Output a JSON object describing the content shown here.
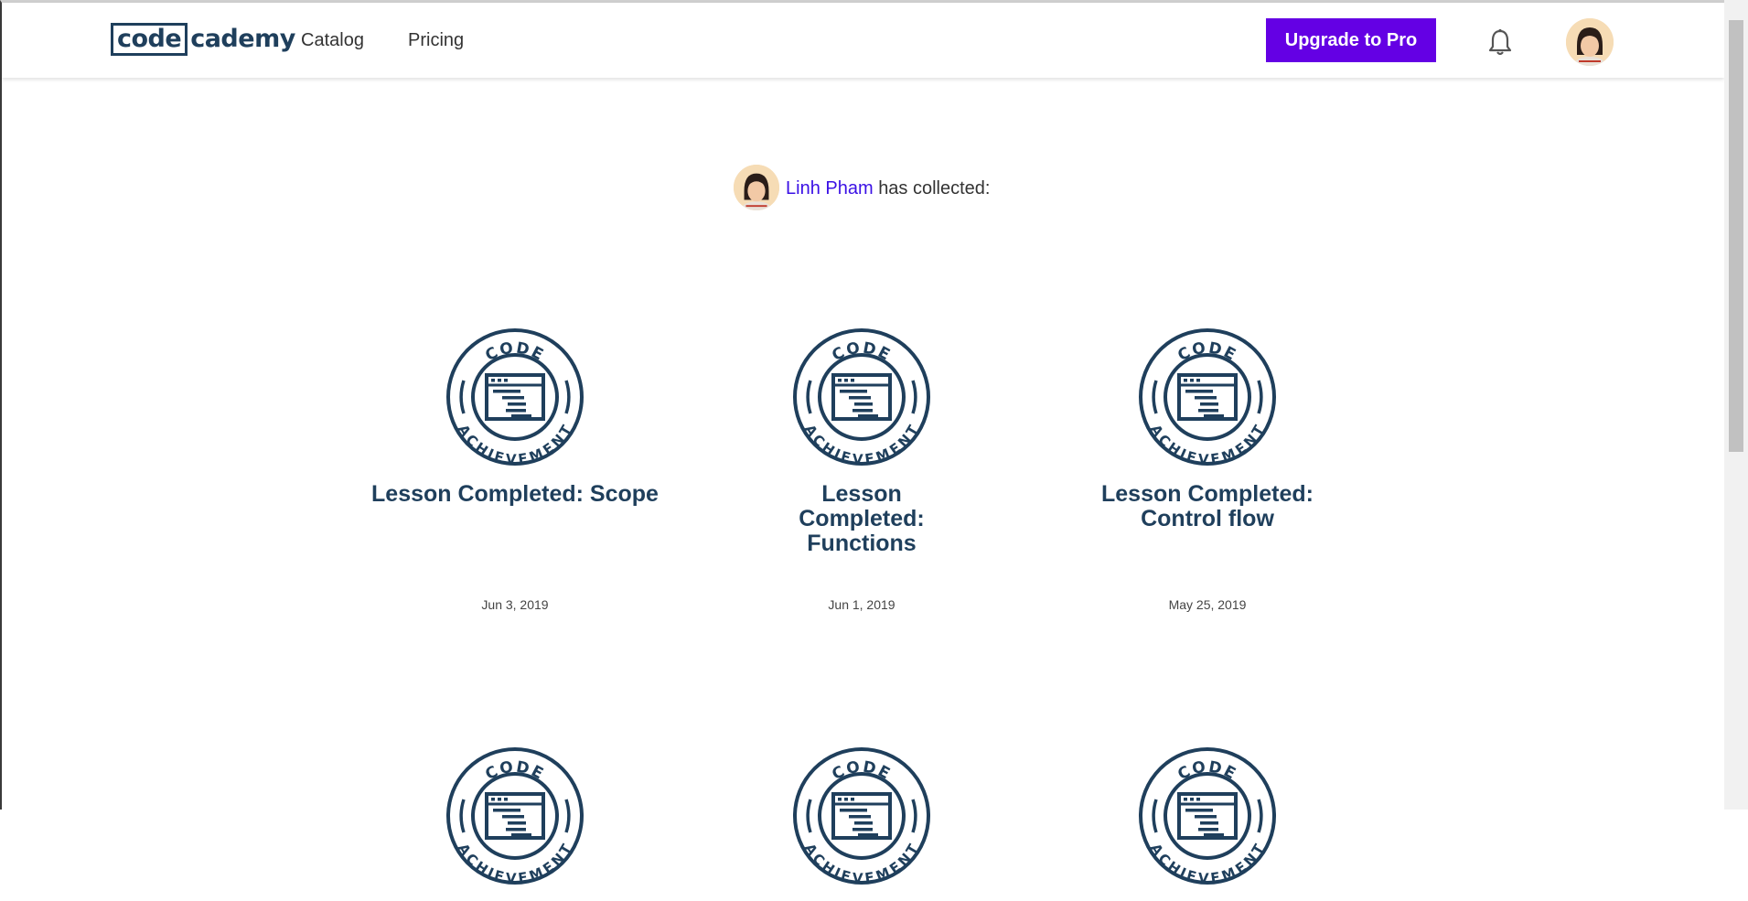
{
  "header": {
    "logo": {
      "box_text": "code",
      "rest_text": "cademy"
    },
    "nav": [
      {
        "label": "Catalog"
      },
      {
        "label": "Pricing"
      }
    ],
    "upgrade_label": "Upgrade to Pro",
    "icons": {
      "notifications": "bell-icon",
      "avatar": "user-avatar"
    }
  },
  "profile": {
    "user_name": "Linh Pham",
    "collected_text": "has collected:"
  },
  "badge": {
    "top_text": "CODE",
    "bottom_text": "ACHIEVEMENT",
    "color": "#1f3f5c"
  },
  "achievements": [
    {
      "title": "Lesson Completed: Scope",
      "date": "Jun 3, 2019"
    },
    {
      "title": "Lesson Completed: Functions",
      "date": "Jun 1, 2019"
    },
    {
      "title": "Lesson Completed: Control flow",
      "date": "May 25, 2019"
    },
    {
      "title": "",
      "date": ""
    },
    {
      "title": "",
      "date": ""
    },
    {
      "title": "",
      "date": ""
    }
  ],
  "colors": {
    "brand": "#1f3f5c",
    "accent": "#6400e4",
    "link": "#3a10e5"
  }
}
